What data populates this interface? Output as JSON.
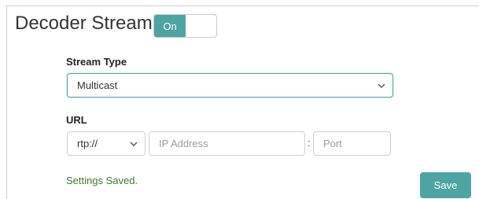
{
  "header": {
    "title": "Decoder Stream",
    "toggle": {
      "label": "On",
      "state": "on"
    }
  },
  "stream_type": {
    "label": "Stream Type",
    "selected": "Multicast"
  },
  "url": {
    "label": "URL",
    "protocol_selected": "rtp://",
    "ip_placeholder": "IP Address",
    "separator": ":",
    "port_placeholder": "Port"
  },
  "footer": {
    "status_text": "Settings Saved.",
    "save_label": "Save"
  },
  "colors": {
    "accent": "#4ea3a3",
    "status_success": "#3c7a2f"
  },
  "icons": {
    "select_chevron": "chevron-down-icon"
  }
}
